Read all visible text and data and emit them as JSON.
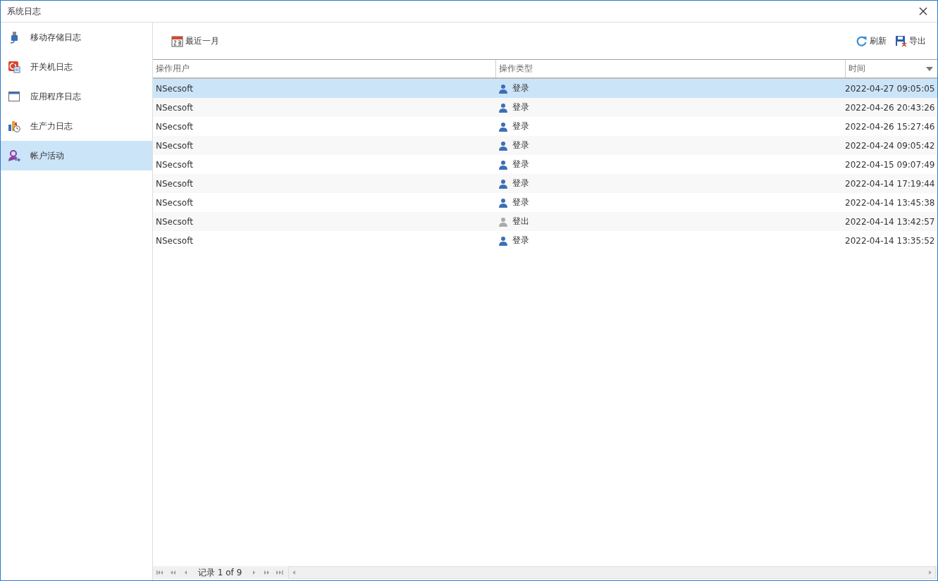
{
  "window": {
    "title": "系统日志"
  },
  "sidebar": {
    "items": [
      {
        "label": "移动存储日志",
        "kind": "usb",
        "selected": false
      },
      {
        "label": "开关机日志",
        "kind": "power",
        "selected": false
      },
      {
        "label": "应用程序日志",
        "kind": "app",
        "selected": false
      },
      {
        "label": "生产力日志",
        "kind": "productivity",
        "selected": false
      },
      {
        "label": "帐户活动",
        "kind": "account",
        "selected": true
      }
    ]
  },
  "toolbar": {
    "date_range": "最近一月",
    "refresh": "刷新",
    "export": "导出"
  },
  "table": {
    "columns": [
      "操作用户",
      "操作类型",
      "时间"
    ],
    "rows": [
      {
        "user": "NSecsoft",
        "kind": "login",
        "type": "登录",
        "time": "2022-04-27 09:05:05",
        "selected": true
      },
      {
        "user": "NSecsoft",
        "kind": "login",
        "type": "登录",
        "time": "2022-04-26 20:43:26",
        "selected": false
      },
      {
        "user": "NSecsoft",
        "kind": "login",
        "type": "登录",
        "time": "2022-04-26 15:27:46",
        "selected": false
      },
      {
        "user": "NSecsoft",
        "kind": "login",
        "type": "登录",
        "time": "2022-04-24 09:05:42",
        "selected": false
      },
      {
        "user": "NSecsoft",
        "kind": "login",
        "type": "登录",
        "time": "2022-04-15 09:07:49",
        "selected": false
      },
      {
        "user": "NSecsoft",
        "kind": "login",
        "type": "登录",
        "time": "2022-04-14 17:19:44",
        "selected": false
      },
      {
        "user": "NSecsoft",
        "kind": "login",
        "type": "登录",
        "time": "2022-04-14 13:45:38",
        "selected": false
      },
      {
        "user": "NSecsoft",
        "kind": "logout",
        "type": "登出",
        "time": "2022-04-14 13:42:57",
        "selected": false
      },
      {
        "user": "NSecsoft",
        "kind": "login",
        "type": "登录",
        "time": "2022-04-14 13:35:52",
        "selected": false
      }
    ]
  },
  "pager": {
    "text": "记录 1 of 9"
  }
}
